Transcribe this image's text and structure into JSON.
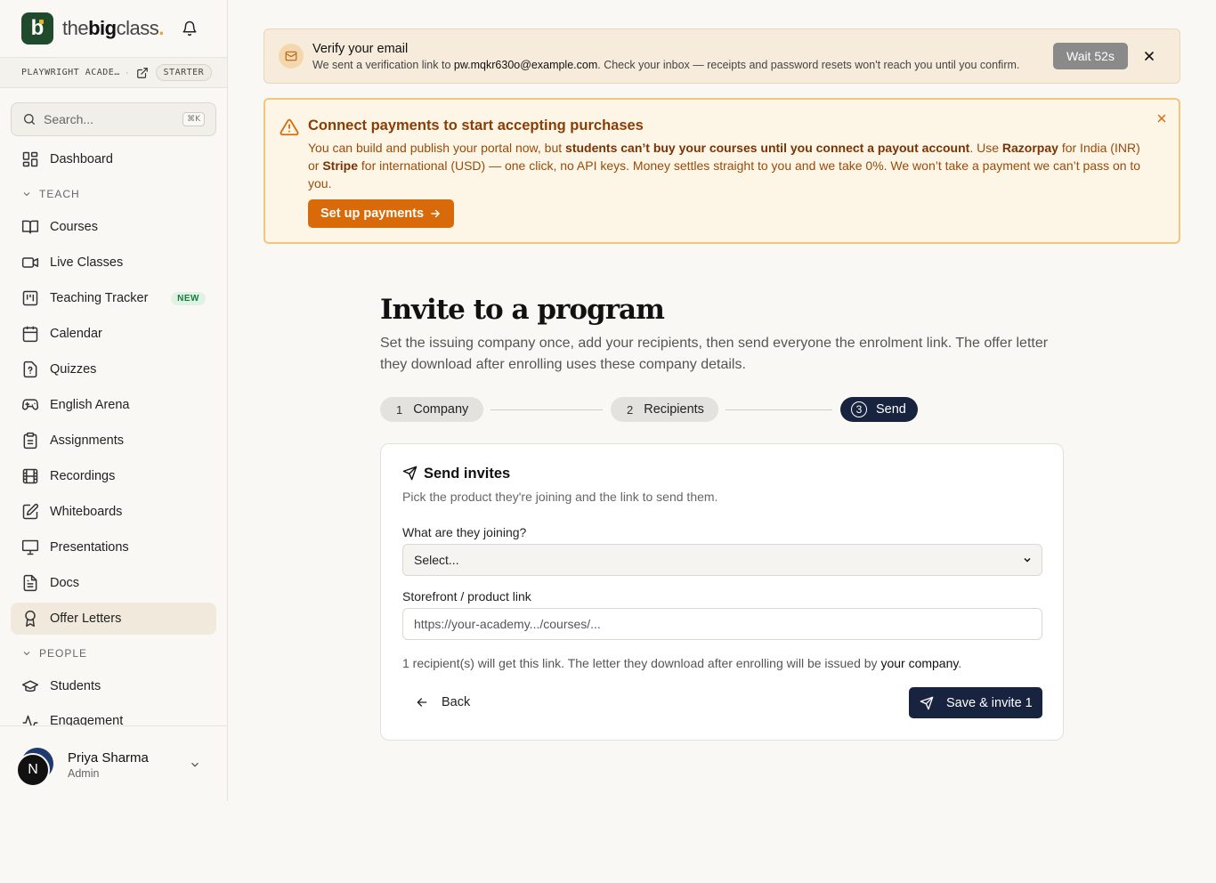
{
  "brand": {
    "word_thin": "the",
    "word_bold": "big",
    "word_end": "class",
    "word_dot": ".",
    "logo_letter": "b"
  },
  "academy": {
    "name": "PLAYWRIGHT ACADE…",
    "separator": "·",
    "plan": "STARTER"
  },
  "search": {
    "placeholder": "Search...",
    "shortcut": "⌘K"
  },
  "nav": {
    "dashboard": "Dashboard",
    "section_teach": "TEACH",
    "courses": "Courses",
    "live_classes": "Live Classes",
    "teaching_tracker": "Teaching Tracker",
    "new_badge": "NEW",
    "calendar": "Calendar",
    "quizzes": "Quizzes",
    "english_arena": "English Arena",
    "assignments": "Assignments",
    "recordings": "Recordings",
    "whiteboards": "Whiteboards",
    "presentations": "Presentations",
    "docs": "Docs",
    "offer_letters": "Offer Letters",
    "section_people": "PEOPLE",
    "students": "Students",
    "engagement": "Engagement"
  },
  "user": {
    "initial": "N",
    "name": "Priya Sharma",
    "role": "Admin"
  },
  "verify": {
    "title": "Verify your email",
    "text_before": "We sent a verification link to ",
    "email": "pw.mqkr630o@example.com",
    "text_after": ". Check your inbox — receipts and password resets won't reach you until you confirm.",
    "wait_label": "Wait 52s"
  },
  "payments": {
    "title": "Connect payments to start accepting purchases",
    "t1": "You can build and publish your portal now, but ",
    "b1": "students can’t buy your courses until you connect a payout account",
    "t2": ". Use ",
    "b2": "Razorpay",
    "t3": " for India (INR) or ",
    "b3": "Stripe",
    "t4": "  for international (USD) — one click, no API keys. Money settles straight to you and we take 0%. We won’t take a payment we can’t pass on to you.",
    "button": "Set up payments"
  },
  "page": {
    "title": "Invite to a program",
    "subtitle": "Set the issuing company once, add your recipients, then send everyone the enrolment link. The offer letter they download after enrolling uses these company details."
  },
  "steps": [
    {
      "num": "1",
      "label": "Company"
    },
    {
      "num": "2",
      "label": "Recipients"
    },
    {
      "num": "3",
      "label": "Send"
    }
  ],
  "card": {
    "title": "Send invites",
    "subtitle": "Pick the product they're joining and the link to send them.",
    "joining_label": "What are they joining?",
    "joining_value": "Select...",
    "link_label": "Storefront / product link",
    "link_placeholder": "https://your-academy.../courses/...",
    "info_before": "1 recipient(s) will get this link. The letter they download after enrolling will be issued by ",
    "info_company": "your company",
    "info_after": ".",
    "back_label": "Back",
    "invite_label": "Save & invite 1"
  },
  "colors": {
    "accent_dark": "#17233f",
    "accent_orange": "#d96a0a",
    "brand_green": "#1f4a2c"
  }
}
